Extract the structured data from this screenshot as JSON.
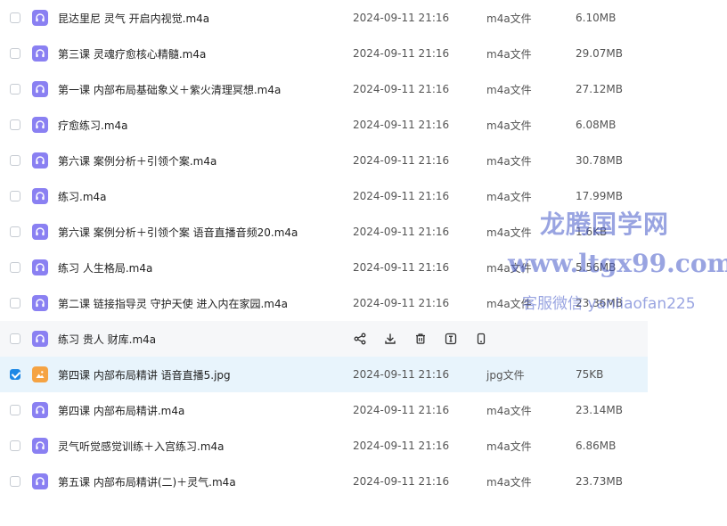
{
  "files": [
    {
      "name": "昆达里尼 灵气 开启内视觉.m4a",
      "date": "2024-09-11 21:16",
      "type": "m4a文件",
      "size": "6.10MB",
      "icon": "audio-file-icon",
      "checked": false
    },
    {
      "name": "第三课  灵魂疗愈核心精髓.m4a",
      "date": "2024-09-11 21:16",
      "type": "m4a文件",
      "size": "29.07MB",
      "icon": "audio-file-icon",
      "checked": false
    },
    {
      "name": "第一课 内部布局基础象义＋紫火清理冥想.m4a",
      "date": "2024-09-11 21:16",
      "type": "m4a文件",
      "size": "27.12MB",
      "icon": "audio-file-icon",
      "checked": false
    },
    {
      "name": "疗愈练习.m4a",
      "date": "2024-09-11 21:16",
      "type": "m4a文件",
      "size": "6.08MB",
      "icon": "audio-file-icon",
      "checked": false
    },
    {
      "name": "第六课   案例分析＋引领个案.m4a",
      "date": "2024-09-11 21:16",
      "type": "m4a文件",
      "size": "30.78MB",
      "icon": "audio-file-icon",
      "checked": false
    },
    {
      "name": "练习.m4a",
      "date": "2024-09-11 21:16",
      "type": "m4a文件",
      "size": "17.99MB",
      "icon": "audio-file-icon",
      "checked": false
    },
    {
      "name": "第六课   案例分析＋引领个案 语音直播音频20.m4a",
      "date": "2024-09-11 21:16",
      "type": "m4a文件",
      "size": "1.6KB",
      "icon": "audio-file-icon",
      "checked": false
    },
    {
      "name": "练习 人生格局.m4a",
      "date": "2024-09-11 21:16",
      "type": "m4a文件",
      "size": "5.56MB",
      "icon": "audio-file-icon",
      "checked": false
    },
    {
      "name": "第二课 链接指导灵 守护天使 进入内在家园.m4a",
      "date": "2024-09-11 21:16",
      "type": "m4a文件",
      "size": "23.36MB",
      "icon": "audio-file-icon",
      "checked": false
    },
    {
      "name": "练习 贵人 财库.m4a",
      "date": "",
      "type": "",
      "size": "",
      "icon": "audio-file-icon",
      "checked": false,
      "hover": true
    },
    {
      "name": "第四课 内部布局精讲 语音直播5.jpg",
      "date": "2024-09-11 21:16",
      "type": "jpg文件",
      "size": "75KB",
      "icon": "image-file-icon",
      "checked": true
    },
    {
      "name": "第四课 内部布局精讲.m4a",
      "date": "2024-09-11 21:16",
      "type": "m4a文件",
      "size": "23.14MB",
      "icon": "audio-file-icon",
      "checked": false
    },
    {
      "name": "灵气听觉感觉训练＋入宫练习.m4a",
      "date": "2024-09-11 21:16",
      "type": "m4a文件",
      "size": "6.86MB",
      "icon": "audio-file-icon",
      "checked": false
    },
    {
      "name": "第五课 内部布局精讲(二)＋灵气.m4a",
      "date": "2024-09-11 21:16",
      "type": "m4a文件",
      "size": "23.73MB",
      "icon": "audio-file-icon",
      "checked": false
    }
  ],
  "row_actions": [
    "share-icon",
    "download-icon",
    "delete-icon",
    "rename-icon",
    "mobile-icon"
  ],
  "watermark": {
    "line1": "龙腾国学网",
    "line2": "www.ltgx99.com",
    "line3": "客服微信 yanliaofan225"
  },
  "colors": {
    "audio_icon": "#8a80f2",
    "image_icon": "#f5a343",
    "selected_row": "#e8f4fc",
    "hover_row": "#f6f7f9",
    "checkbox_checked": "#1e88e5"
  }
}
